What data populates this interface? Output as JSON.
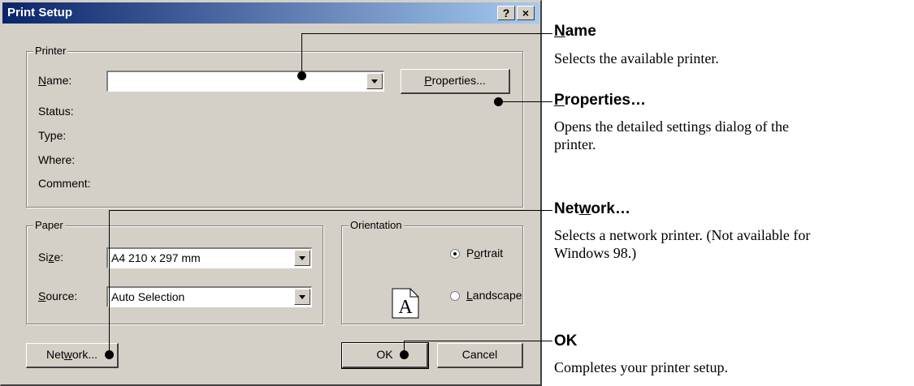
{
  "dialog": {
    "title": "Print Setup",
    "help_btn": "?",
    "close_btn": "×"
  },
  "printer": {
    "group_label": "Printer",
    "name_label_u": "N",
    "name_label_rest": "ame:",
    "name_value": "",
    "properties_u": "P",
    "properties_rest": "roperties...",
    "status_label": "Status:",
    "type_label": "Type:",
    "where_label": "Where:",
    "comment_label": "Comment:"
  },
  "paper": {
    "group_label": "Paper",
    "size_label_pre": "Si",
    "size_label_u": "z",
    "size_label_post": "e:",
    "size_value": "A4 210 x 297 mm",
    "source_label_u": "S",
    "source_label_rest": "ource:",
    "source_value": "Auto Selection"
  },
  "orientation": {
    "group_label": "Orientation",
    "icon_letter": "A",
    "portrait_pre": "P",
    "portrait_u": "o",
    "portrait_post": "rtrait",
    "landscape_pre": "",
    "landscape_u": "L",
    "landscape_post": "andscape",
    "selected": "portrait"
  },
  "buttons": {
    "network_pre": "Net",
    "network_u": "w",
    "network_post": "ork...",
    "ok": "OK",
    "cancel": "Cancel"
  },
  "annotations": [
    {
      "head_u": "N",
      "head_rest": "ame",
      "head_pre": "",
      "desc": [
        "Selects the available printer."
      ]
    },
    {
      "head_u": "P",
      "head_rest": "roperties…",
      "head_pre": "",
      "desc": [
        "Opens the detailed settings dialog of the",
        "printer."
      ]
    },
    {
      "head_pre": "Net",
      "head_u": "w",
      "head_rest": "ork…",
      "desc": [
        "Selects a network printer. (Not available for",
        "Windows 98.)"
      ]
    },
    {
      "head_pre": "",
      "head_u": "",
      "head_rest": "OK",
      "desc": [
        "Completes your printer setup."
      ]
    }
  ]
}
